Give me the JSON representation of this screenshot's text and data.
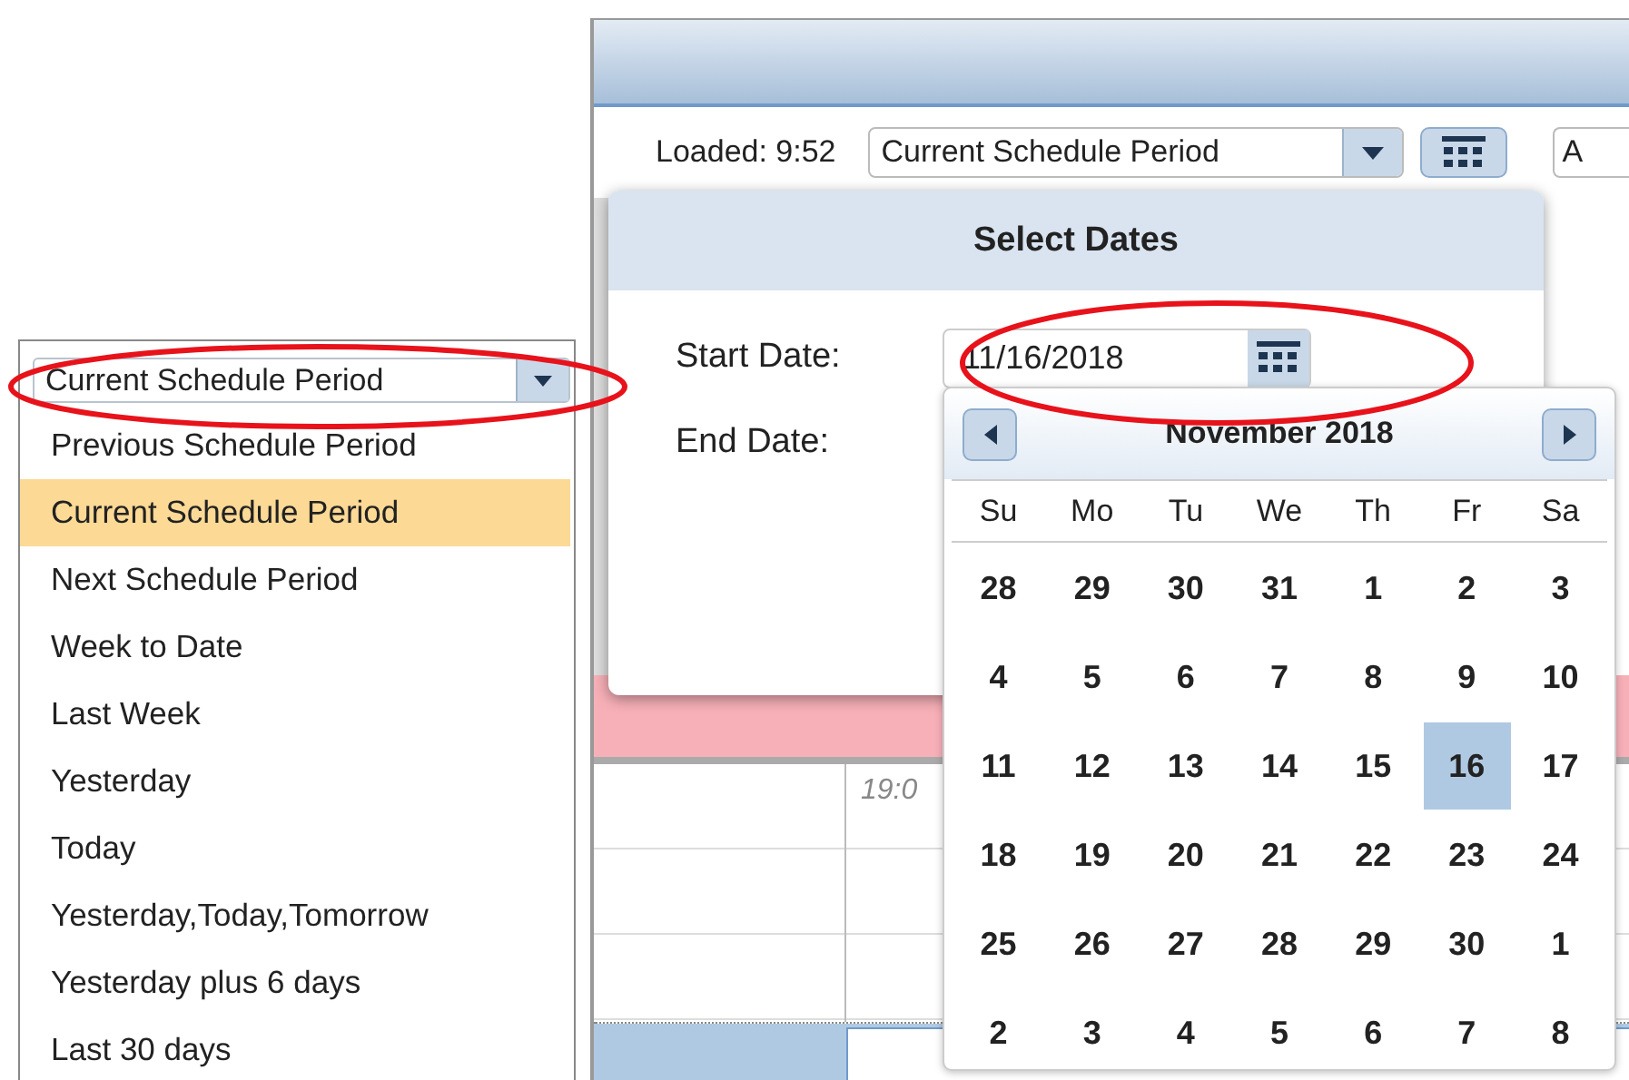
{
  "left_panel": {
    "period_select": {
      "value": "Current Schedule Period"
    },
    "options": [
      {
        "label": "Previous Schedule Period",
        "selected": false
      },
      {
        "label": "Current Schedule Period",
        "selected": true
      },
      {
        "label": "Next Schedule Period",
        "selected": false
      },
      {
        "label": "Week to Date",
        "selected": false
      },
      {
        "label": "Last Week",
        "selected": false
      },
      {
        "label": "Yesterday",
        "selected": false
      },
      {
        "label": "Today",
        "selected": false
      },
      {
        "label": "Yesterday,Today,Tomorrow",
        "selected": false
      },
      {
        "label": "Yesterday plus 6 days",
        "selected": false
      },
      {
        "label": "Last 30 days",
        "selected": false
      }
    ]
  },
  "toolbar": {
    "loaded": "Loaded: 9:52",
    "period_select": {
      "value": "Current Schedule Period"
    },
    "field_3": {
      "value": "A"
    }
  },
  "timeline": {
    "time_label": "19:0"
  },
  "dialog": {
    "title": "Select Dates",
    "start_label": "Start Date:",
    "start_value": "11/16/2018",
    "end_label": "End Date:"
  },
  "calendar": {
    "month": "November 2018",
    "weekdays": [
      "Su",
      "Mo",
      "Tu",
      "We",
      "Th",
      "Fr",
      "Sa"
    ],
    "weeks": [
      [
        {
          "day": "28",
          "selected": false
        },
        {
          "day": "29",
          "selected": false
        },
        {
          "day": "30",
          "selected": false
        },
        {
          "day": "31",
          "selected": false
        },
        {
          "day": "1",
          "selected": false
        },
        {
          "day": "2",
          "selected": false
        },
        {
          "day": "3",
          "selected": false
        }
      ],
      [
        {
          "day": "4",
          "selected": false
        },
        {
          "day": "5",
          "selected": false
        },
        {
          "day": "6",
          "selected": false
        },
        {
          "day": "7",
          "selected": false
        },
        {
          "day": "8",
          "selected": false
        },
        {
          "day": "9",
          "selected": false
        },
        {
          "day": "10",
          "selected": false
        }
      ],
      [
        {
          "day": "11",
          "selected": false
        },
        {
          "day": "12",
          "selected": false
        },
        {
          "day": "13",
          "selected": false
        },
        {
          "day": "14",
          "selected": false
        },
        {
          "day": "15",
          "selected": false
        },
        {
          "day": "16",
          "selected": true
        },
        {
          "day": "17",
          "selected": false
        }
      ],
      [
        {
          "day": "18",
          "selected": false
        },
        {
          "day": "19",
          "selected": false
        },
        {
          "day": "20",
          "selected": false
        },
        {
          "day": "21",
          "selected": false
        },
        {
          "day": "22",
          "selected": false
        },
        {
          "day": "23",
          "selected": false
        },
        {
          "day": "24",
          "selected": false
        }
      ],
      [
        {
          "day": "25",
          "selected": false
        },
        {
          "day": "26",
          "selected": false
        },
        {
          "day": "27",
          "selected": false
        },
        {
          "day": "28",
          "selected": false
        },
        {
          "day": "29",
          "selected": false
        },
        {
          "day": "30",
          "selected": false
        },
        {
          "day": "1",
          "selected": false
        }
      ],
      [
        {
          "day": "2",
          "selected": false
        },
        {
          "day": "3",
          "selected": false
        },
        {
          "day": "4",
          "selected": false
        },
        {
          "day": "5",
          "selected": false
        },
        {
          "day": "6",
          "selected": false
        },
        {
          "day": "7",
          "selected": false
        },
        {
          "day": "8",
          "selected": false
        }
      ]
    ]
  }
}
